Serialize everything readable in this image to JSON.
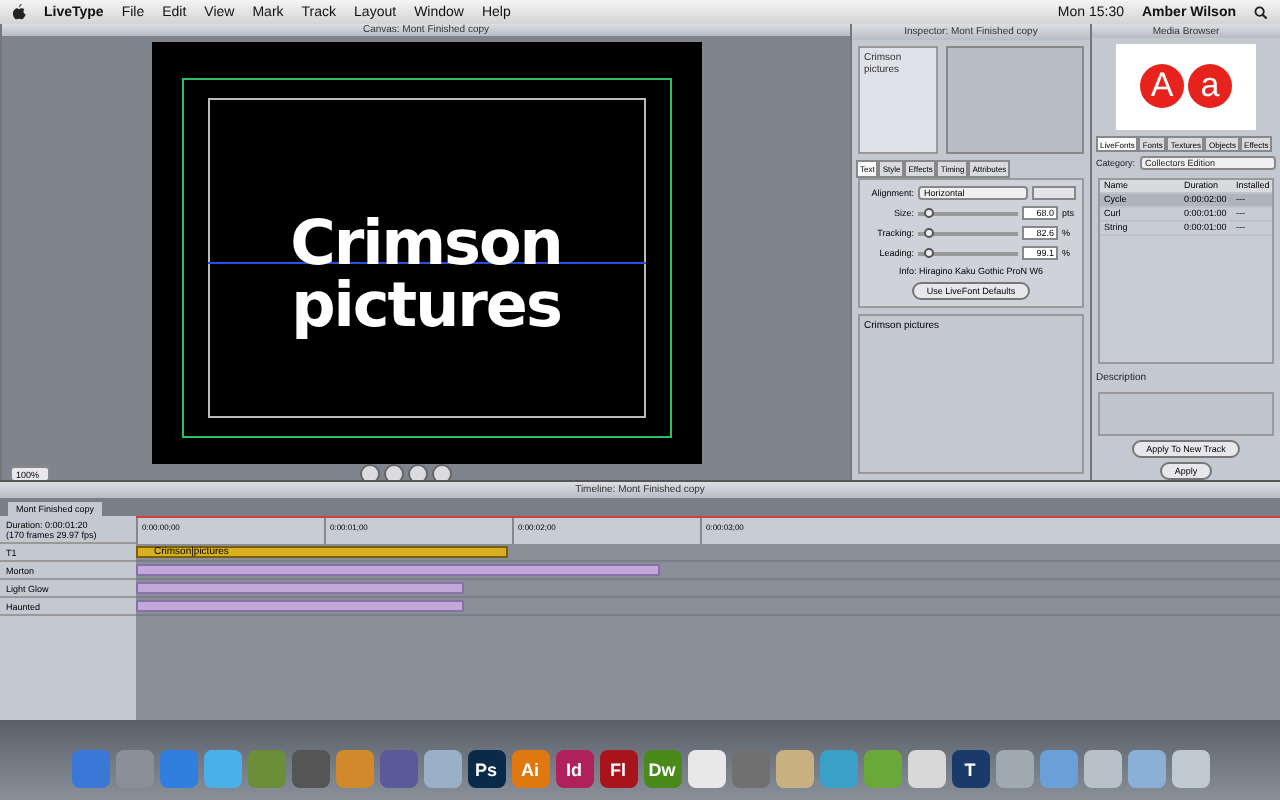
{
  "menubar": {
    "menus": [
      "LiveType",
      "File",
      "Edit",
      "View",
      "Mark",
      "Track",
      "Layout",
      "Window",
      "Help"
    ],
    "clock": "Mon 15:30",
    "user": "Amber Wilson"
  },
  "canvas": {
    "title": "Canvas: Mont Finished copy",
    "text": [
      "Crimson",
      "pictures"
    ],
    "zoom": "100%"
  },
  "inspector": {
    "title": "Inspector: Mont Finished copy",
    "preview_text": "Crimson pictures",
    "tabs": [
      {
        "label": "Text",
        "selected": true
      },
      {
        "label": "Style",
        "selected": false
      },
      {
        "label": "Effects",
        "selected": false
      },
      {
        "label": "Timing",
        "selected": false
      },
      {
        "label": "Attributes",
        "selected": false
      }
    ],
    "alignment_label": "Alignment:",
    "alignment": "Horizontal",
    "sliders": [
      {
        "label": "Size:",
        "value": "68.0",
        "unit": "pts",
        "level": 0.05
      },
      {
        "label": "Tracking:",
        "value": "82.6",
        "unit": "%",
        "level": 0.05
      },
      {
        "label": "Leading:",
        "value": "99.1",
        "unit": "%",
        "level": 0.05
      }
    ],
    "info": "Info: Hiragino Kaku Gothic ProN W6",
    "defaults_button": "Use LiveFont Defaults",
    "text_entry": "Crimson pictures"
  },
  "media_browser": {
    "title": "Media Browser",
    "preview_glyphs": [
      "A",
      "a"
    ],
    "tabs": [
      {
        "label": "LiveFonts",
        "selected": true
      },
      {
        "label": "Fonts",
        "selected": false
      },
      {
        "label": "Textures",
        "selected": false
      },
      {
        "label": "Objects",
        "selected": false
      },
      {
        "label": "Effects",
        "selected": false
      }
    ],
    "category_label": "Category:",
    "category": "Collectors Edition",
    "columns": [
      "Name",
      "Duration",
      "Installed"
    ],
    "rows": [
      {
        "name": "Cycle",
        "duration": "0:00:02:00",
        "installed": "---",
        "selected": true
      },
      {
        "name": "Curl",
        "duration": "0:00:01:00",
        "installed": "---",
        "selected": false
      },
      {
        "name": "String",
        "duration": "0:00:01:00",
        "installed": "---",
        "selected": false
      }
    ],
    "description_label": "Description",
    "buttons": [
      "Apply To New Track",
      "Apply"
    ]
  },
  "timeline": {
    "title": "Timeline: Mont Finished copy",
    "tab": "Mont Finished copy",
    "duration": "Duration: 0:00:01:20",
    "frames": "(170 frames 29.97 fps)",
    "ticks": [
      "0:00:00;00",
      "0:00:01;00",
      "0:00:02;00",
      "0:00:03;00"
    ],
    "tracks": [
      {
        "name": "T1",
        "kind": "text",
        "clip": "Crimson|pictures"
      },
      {
        "name": "Morton",
        "kind": "effect"
      },
      {
        "name": "Light Glow",
        "kind": "effect"
      },
      {
        "name": "Haunted",
        "kind": "effect"
      }
    ]
  },
  "dock": {
    "items": [
      {
        "kind": "icon",
        "color": "#3a78d8"
      },
      {
        "kind": "icon",
        "color": "#8a8f98"
      },
      {
        "kind": "icon",
        "color": "#2f7ee0"
      },
      {
        "kind": "icon",
        "color": "#4ab0e8"
      },
      {
        "kind": "icon",
        "color": "#6b8e3a"
      },
      {
        "kind": "icon",
        "color": "#555555"
      },
      {
        "kind": "icon",
        "color": "#d08a2a"
      },
      {
        "kind": "icon",
        "color": "#5a5a9a"
      },
      {
        "kind": "icon",
        "color": "#9ab0c8"
      },
      {
        "kind": "label",
        "label": "Ps",
        "color": "#0a2a4a"
      },
      {
        "kind": "label",
        "label": "Ai",
        "color": "#e07810"
      },
      {
        "kind": "label",
        "label": "Id",
        "color": "#b0205a"
      },
      {
        "kind": "label",
        "label": "Fl",
        "color": "#a8141c"
      },
      {
        "kind": "label",
        "label": "Dw",
        "color": "#4a8a1a"
      },
      {
        "kind": "icon",
        "color": "#e8e8e8"
      },
      {
        "kind": "icon",
        "color": "#707070"
      },
      {
        "kind": "icon",
        "color": "#c8b080"
      },
      {
        "kind": "icon",
        "color": "#3aa0c8"
      },
      {
        "kind": "icon",
        "color": "#6aa83a"
      },
      {
        "kind": "icon",
        "color": "#d8d8d8"
      },
      {
        "kind": "label",
        "label": "T",
        "color": "#1a3a6a"
      },
      {
        "kind": "icon",
        "color": "#a0a8b0"
      },
      {
        "kind": "icon",
        "color": "#6aa0d8"
      },
      {
        "kind": "icon",
        "color": "#b8c0c8"
      },
      {
        "kind": "icon",
        "color": "#8ab0d8"
      },
      {
        "kind": "icon",
        "color": "#c0c8d0"
      }
    ]
  }
}
